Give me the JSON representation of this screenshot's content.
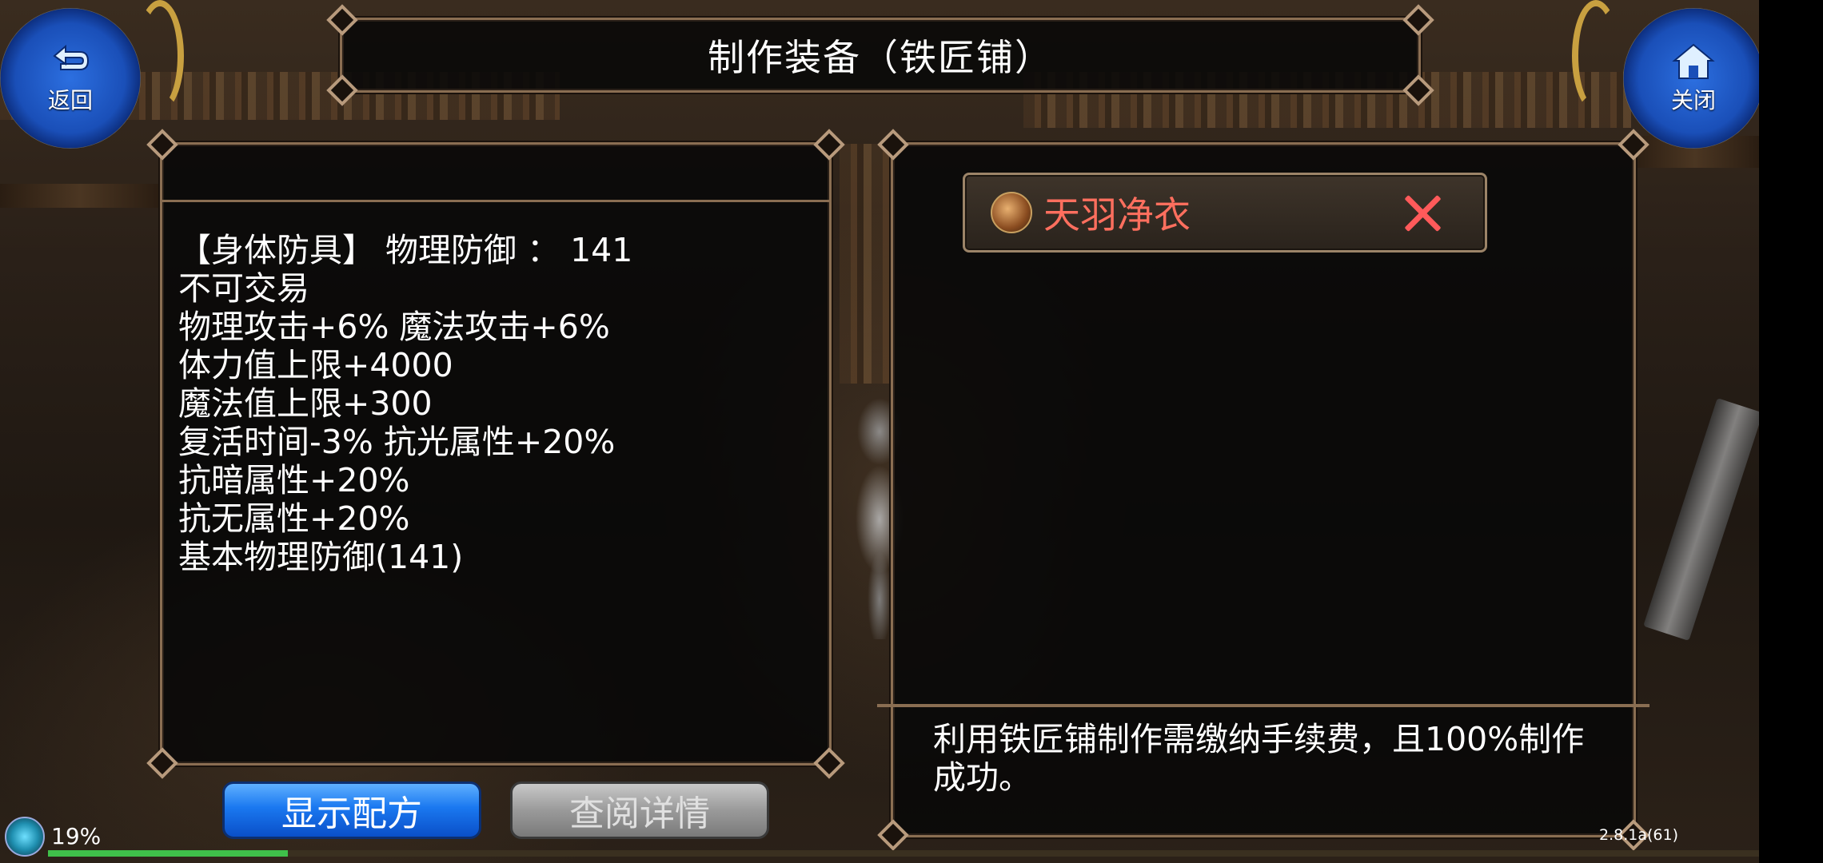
{
  "header": {
    "title": "制作装备（铁匠铺）"
  },
  "nav": {
    "back_label": "返回",
    "close_label": "关闭"
  },
  "item": {
    "stats": [
      "【身体防具】 物理防御 ：  141",
      "不可交易",
      "物理攻击+6% 魔法攻击+6%",
      "体力值上限+4000",
      "魔法值上限+300",
      "复活时间-3% 抗光属性+20%",
      "抗暗属性+20%",
      "抗无属性+20%",
      "基本物理防御(141)"
    ]
  },
  "slot": {
    "item_name": "天羽净衣",
    "icon": "armor-icon"
  },
  "description": "利用铁匠铺制作需缴纳手续费，且100%制作成功。",
  "buttons": {
    "show_recipe": "显示配方",
    "view_details": "查阅详情"
  },
  "status": {
    "battery": "19%",
    "version": "2.8.1a(61)",
    "progress_fraction": 0.14
  },
  "colors": {
    "item_name": "#ff6f5e",
    "primary_button": "#1a78f0",
    "disabled_button": "#9a9a9a",
    "frame": "#8a6e52"
  }
}
